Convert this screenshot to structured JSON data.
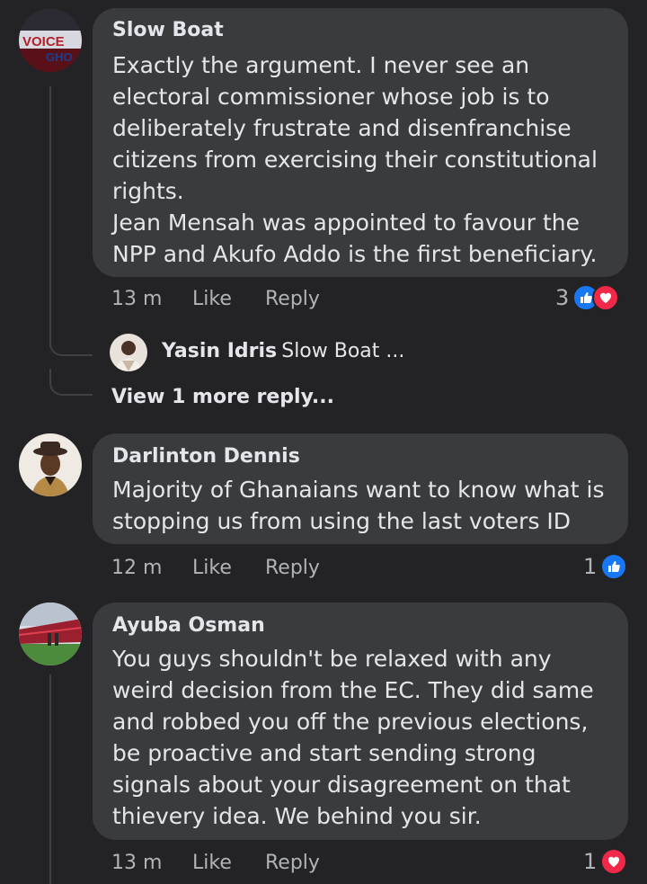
{
  "comments": [
    {
      "author": "Slow Boat",
      "avatar": "voice-gh-logo-avatar",
      "lines": [
        "Exactly the argument. I never see an",
        "electoral commissioner whose job is to",
        "deliberately frustrate and disenfranchise",
        "citizens from exercising their constitutional",
        "rights.",
        "Jean Mensah was appointed to favour the",
        "NPP and Akufo Addo is the first beneficiary."
      ],
      "time": "13 m",
      "like_label": "Like",
      "reply_label": "Reply",
      "reaction_count": "3",
      "reactions": [
        "like",
        "love"
      ],
      "reply_preview": {
        "name": "Yasin Idris",
        "snippet": "Slow Boat ..."
      },
      "view_more_label": "View 1 more reply..."
    },
    {
      "author": "Darlinton Dennis",
      "avatar": "man-with-hat-avatar",
      "lines": [
        "Majority of Ghanaians want to know what is",
        "stopping us from using the last voters ID"
      ],
      "time": "12 m",
      "like_label": "Like",
      "reply_label": "Reply",
      "reaction_count": "1",
      "reactions": [
        "like"
      ]
    },
    {
      "author": "Ayuba Osman",
      "avatar": "stadium-avatar",
      "lines": [
        "You guys shouldn't be relaxed with any",
        "weird decision from the EC. They did same",
        "and robbed you off the previous elections,",
        "be proactive and start sending strong",
        "signals about your disagreement on that",
        "thievery idea. We behind you sir."
      ],
      "time": "13 m",
      "like_label": "Like",
      "reply_label": "Reply",
      "reaction_count": "1",
      "reactions": [
        "love"
      ]
    }
  ],
  "colors": {
    "background": "#232325",
    "bubble": "#3a3b3c",
    "text": "#e4e6eb",
    "muted": "#b0b3b8",
    "like_blue": "#1877f2",
    "love_red": "#f02849"
  }
}
